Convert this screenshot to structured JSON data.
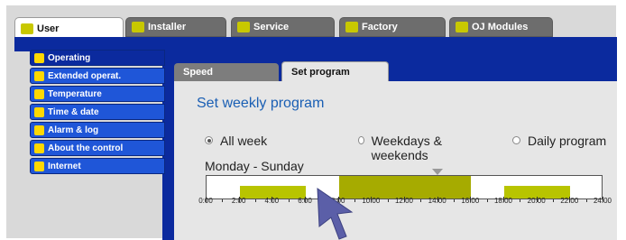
{
  "top_tabs": [
    {
      "label": "User",
      "active": true
    },
    {
      "label": "Installer",
      "active": false
    },
    {
      "label": "Service",
      "active": false
    },
    {
      "label": "Factory",
      "active": false
    },
    {
      "label": "OJ Modules",
      "active": false
    }
  ],
  "sidebar": {
    "items": [
      {
        "label": "Operating",
        "active": true
      },
      {
        "label": "Extended operat.",
        "active": false
      },
      {
        "label": "Temperature",
        "active": false
      },
      {
        "label": "Time & date",
        "active": false
      },
      {
        "label": "Alarm & log",
        "active": false
      },
      {
        "label": "About the control",
        "active": false
      },
      {
        "label": "Internet",
        "active": false
      }
    ]
  },
  "sub_tabs": [
    {
      "label": "Speed",
      "active": false
    },
    {
      "label": "Set program",
      "active": true
    }
  ],
  "main": {
    "title": "Set weekly program",
    "radio_options": [
      {
        "label": "All week",
        "selected": true
      },
      {
        "label": "Weekdays & weekends",
        "selected": false
      },
      {
        "label": "Daily program",
        "selected": false
      }
    ],
    "day_label": "Monday - Sunday",
    "timeline": {
      "tick_labels": [
        "0:00",
        "2:00",
        "4:00",
        "6:00",
        "8:00",
        "10:00",
        "12:00",
        "14:00",
        "16:00",
        "18:00",
        "20:00",
        "22:00",
        "24:00"
      ],
      "segments": [
        {
          "start_hour": 2.0,
          "end_hour": 6.0,
          "level": "low"
        },
        {
          "start_hour": 8.0,
          "end_hour": 16.0,
          "level": "high"
        },
        {
          "start_hour": 18.0,
          "end_hour": 22.0,
          "level": "low"
        }
      ],
      "marker_hour": 14.0
    }
  },
  "colors": {
    "header_blue": "#0b2a9e",
    "sidebar_blue": "#1f56d8",
    "segment_low": "#b8c400",
    "segment_high": "#a6ab00",
    "title_blue": "#1a5fb4"
  }
}
